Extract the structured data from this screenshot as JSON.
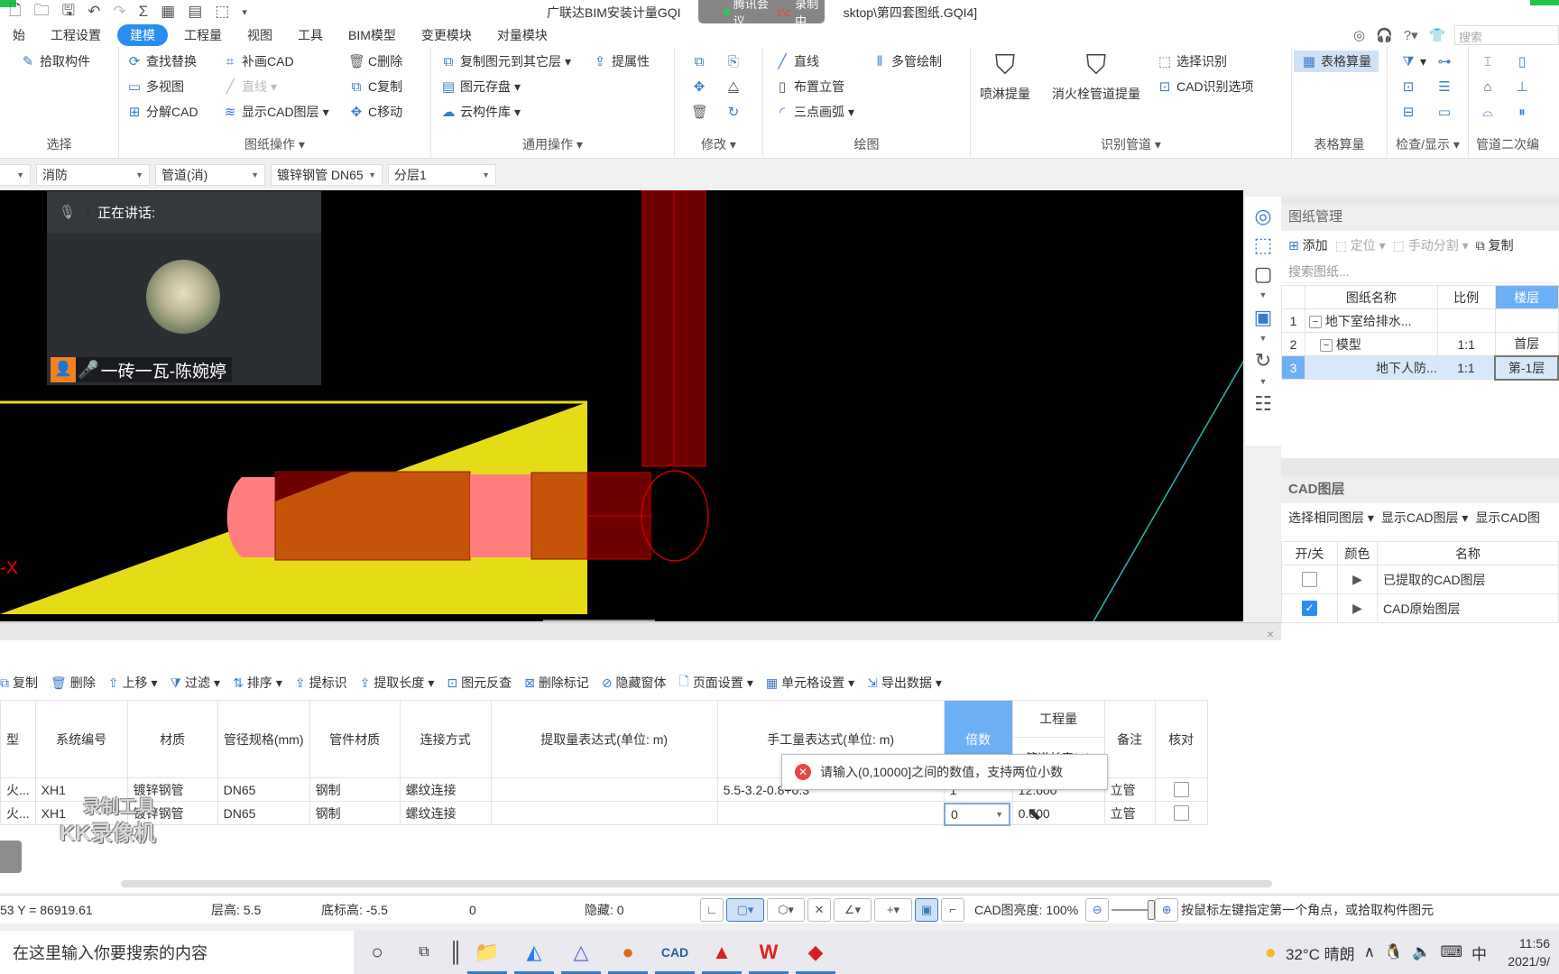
{
  "window": {
    "title": "广联达BIM安装计量GQI2021 - [C:\\Users\\...\\Desktop\\第四套图纸.GQI4]",
    "title_visible_left": "广联达BIM安装计量GQI",
    "title_visible_right": "sktop\\第四套图纸.GQI4]",
    "meeting_overlay": "腾讯会议",
    "recording_label": "录制中"
  },
  "quick_access": [
    "new-file-icon",
    "open-folder-icon",
    "save-icon",
    "undo-icon",
    "redo-icon",
    "sum-icon",
    "table-icon",
    "form-icon",
    "layout-icon",
    "customize-icon"
  ],
  "menu": {
    "items": [
      "始",
      "工程设置",
      "建模",
      "工程量",
      "视图",
      "工具",
      "BIM模型",
      "变更模块",
      "对量模块"
    ],
    "active_index": 2
  },
  "header_right": {
    "search_placeholder": "搜索"
  },
  "ribbon": {
    "groups": [
      {
        "label": "选择",
        "buttons": [
          {
            "label": "拾取构件",
            "icon": "pick-icon"
          }
        ]
      },
      {
        "label": "图纸操作",
        "buttons": [
          {
            "label": "查找替换",
            "icon": "find-replace-icon"
          },
          {
            "label": "多视图",
            "icon": "multi-view-icon"
          },
          {
            "label": "分解CAD",
            "icon": "explode-cad-icon"
          },
          {
            "label": "补画CAD",
            "icon": "draw-cad-icon"
          },
          {
            "label": "直线",
            "icon": "line-icon",
            "disabled": true
          },
          {
            "label": "显示CAD图层",
            "icon": "cad-layer-icon"
          },
          {
            "label": "C删除",
            "icon": "c-delete-icon"
          },
          {
            "label": "C复制",
            "icon": "c-copy-icon"
          },
          {
            "label": "C移动",
            "icon": "c-move-icon"
          }
        ]
      },
      {
        "label": "通用操作",
        "buttons": [
          {
            "label": "复制图元到其它层",
            "icon": "copy-to-layer-icon"
          },
          {
            "label": "图元存盘",
            "icon": "save-element-icon"
          },
          {
            "label": "云构件库",
            "icon": "cloud-library-icon"
          },
          {
            "label": "提属性",
            "icon": "extract-property-icon"
          }
        ]
      },
      {
        "label": "修改",
        "buttons": [
          {
            "label": "",
            "icon": "copy-icon"
          },
          {
            "label": "",
            "icon": "mirror-copy-icon"
          },
          {
            "label": "",
            "icon": "move-icon"
          },
          {
            "label": "",
            "icon": "mirror-icon"
          },
          {
            "label": "",
            "icon": "delete-icon"
          },
          {
            "label": "",
            "icon": "rotate-icon"
          }
        ]
      },
      {
        "label": "绘图",
        "buttons": [
          {
            "label": "直线",
            "icon": "line-icon"
          },
          {
            "label": "布置立管",
            "icon": "riser-icon"
          },
          {
            "label": "三点画弧",
            "icon": "arc-icon"
          },
          {
            "label": "多管绘制",
            "icon": "multi-pipe-icon"
          }
        ]
      },
      {
        "label": "识别管道",
        "buttons": [
          {
            "label": "喷淋提量",
            "icon": "sprinkler-icon"
          },
          {
            "label": "消火栓管道提量",
            "icon": "hydrant-icon"
          },
          {
            "label": "选择识别",
            "icon": "select-recognize-icon"
          },
          {
            "label": "CAD识别选项",
            "icon": "cad-options-icon"
          }
        ]
      },
      {
        "label": "表格算量",
        "buttons": [
          {
            "label": "表格算量",
            "icon": "table-calc-icon",
            "selected": true
          }
        ]
      },
      {
        "label": "检查/显示",
        "buttons": []
      },
      {
        "label": "管道二次编",
        "buttons": []
      }
    ]
  },
  "filters": {
    "values": [
      "",
      "消防",
      "管道(消)",
      "镀锌钢管 DN65",
      "分层1"
    ]
  },
  "meeting": {
    "speaking_label": "正在讲话:",
    "participant": "一砖一瓦-陈婉婷"
  },
  "canvas": {
    "axis_label": "-X"
  },
  "table_toolbar": {
    "items": [
      {
        "label": "复制",
        "icon": "copy-icon"
      },
      {
        "label": "删除",
        "icon": "delete-icon"
      },
      {
        "label": "上移",
        "icon": "move-up-icon",
        "dropdown": true
      },
      {
        "label": "过滤",
        "icon": "filter-icon",
        "dropdown": true
      },
      {
        "label": "排序",
        "icon": "sort-icon",
        "dropdown": true
      },
      {
        "label": "提标识",
        "icon": "extract-label-icon"
      },
      {
        "label": "提取长度",
        "icon": "extract-length-icon",
        "dropdown": true
      },
      {
        "label": "图元反查",
        "icon": "reverse-lookup-icon"
      },
      {
        "label": "删除标记",
        "icon": "delete-mark-icon"
      },
      {
        "label": "隐藏窗体",
        "icon": "hide-window-icon"
      },
      {
        "label": "页面设置",
        "icon": "page-setup-icon",
        "dropdown": true
      },
      {
        "label": "单元格设置",
        "icon": "cell-setting-icon",
        "dropdown": true
      },
      {
        "label": "导出数据",
        "icon": "export-icon",
        "dropdown": true
      }
    ]
  },
  "qty_table": {
    "headers": [
      "型",
      "系统编号",
      "材质",
      "管径规格(mm)",
      "管件材质",
      "连接方式",
      "提取量表达式(单位: m)",
      "手工量表达式(单位: m)",
      "倍数",
      "工程量",
      "备注",
      "核对"
    ],
    "subheader": "管道长度(m)",
    "rows": [
      [
        "火...",
        "XH1",
        "镀锌钢管",
        "DN65",
        "钢制",
        "螺纹连接",
        "",
        "5.5-3.2-0.8+0.3",
        "1",
        "12.600",
        "立管",
        false
      ],
      [
        "火...",
        "XH1",
        "镀锌钢管",
        "DN65",
        "钢制",
        "螺纹连接",
        "",
        "",
        "0",
        "0.000",
        "立管",
        false
      ]
    ],
    "editing_value": "0"
  },
  "tooltip": {
    "message": "请输入(0,10000]之间的数值，支持两位小数"
  },
  "watermark": {
    "line1": "录制工具",
    "line2": "KK录像机"
  },
  "drawing_panel": {
    "title": "图纸管理",
    "tools": [
      {
        "label": "添加"
      },
      {
        "label": "定位",
        "disabled": true
      },
      {
        "label": "手动分割",
        "disabled": true
      },
      {
        "label": "复制"
      }
    ],
    "search_placeholder": "搜索图纸...",
    "headers": [
      "",
      "图纸名称",
      "比例",
      "楼层"
    ],
    "rows": [
      {
        "num": "1",
        "name": "地下室给排水...",
        "scale": "",
        "floor": "",
        "expand": "−"
      },
      {
        "num": "2",
        "name": "模型",
        "scale": "1:1",
        "floor": "首层",
        "expand": "−"
      },
      {
        "num": "3",
        "name": "地下人防...",
        "scale": "1:1",
        "floor": "第-1层",
        "selected": true
      }
    ]
  },
  "cad_layer_panel": {
    "title": "CAD图层",
    "tools": [
      "选择相同图层",
      "显示CAD图层",
      "显示CAD图"
    ],
    "headers": [
      "开/关",
      "颜色",
      "名称"
    ],
    "rows": [
      {
        "on": false,
        "name": "已提取的CAD图层"
      },
      {
        "on": true,
        "name": "CAD原始图层"
      }
    ]
  },
  "statusbar": {
    "coords": "53 Y = 86919.61",
    "floor_height": "层高: 5.5",
    "base_elevation": "底标高: -5.5",
    "zero": "0",
    "hidden": "隐藏: 0",
    "cad_brightness": "CAD图亮度: 100%",
    "hint": "按鼠标左键指定第一个角点，或拾取构件图元"
  },
  "taskbar": {
    "search_placeholder": "在这里输入你要搜索的内容",
    "weather": "32°C 晴朗",
    "ime": "中",
    "time": "11:56",
    "date": "2021/9/"
  }
}
